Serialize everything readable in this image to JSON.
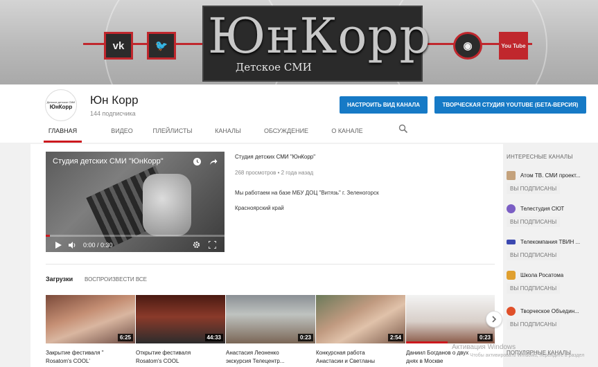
{
  "banner": {
    "logo": "ЮнКорр",
    "subtitle": "Детское СМИ",
    "social": [
      "vk-icon",
      "twitter-icon",
      "ok-icon",
      "youtube-icon"
    ],
    "social_labels": [
      "vk",
      "🐦",
      "◉",
      "You Tube"
    ],
    "accent": "#c0272d"
  },
  "channel": {
    "avatar_line1": "Детское детское СМИ",
    "avatar_line2": "ЮнКорр",
    "name": "Юн Корр",
    "subscribers": "144 подписчика",
    "btn_customize": "НАСТРОИТЬ ВИД КАНАЛА",
    "btn_studio": "ТВОРЧЕСКАЯ СТУДИЯ YOUTUBE (БЕТА-ВЕРСИЯ)",
    "tabs": [
      "ГЛАВНАЯ",
      "ВИДЕО",
      "ПЛЕЙЛИСТЫ",
      "КАНАЛЫ",
      "ОБСУЖДЕНИЕ",
      "О КАНАЛЕ"
    ],
    "accent": "#167ac6"
  },
  "featured": {
    "player_title": "Студия детских СМИ \"ЮнКорр\"",
    "time": "0:00 / 0:30",
    "title": "Студия детских СМИ \"ЮнКорр\"",
    "meta": "268 просмотров • 2 года назад",
    "desc_line1": "Мы работаем на базе  МБУ ДОЦ \"Витязь\" г. Зеленогорск",
    "desc_line2": "Красноярский край"
  },
  "uploads": {
    "heading": "Загрузки",
    "play_all": "ВОСПРОИЗВЕСТИ ВСЕ",
    "videos": [
      {
        "title1": "Закрытие фестиваля \"",
        "title2": "Rosatom's COOL'",
        "duration": "6:25"
      },
      {
        "title1": "Открытие фестиваля",
        "title2": "Rosatom's COOL",
        "duration": "44:33"
      },
      {
        "title1": "Анастасия Леоненко",
        "title2": "экскурсия Телецентр...",
        "duration": "0:23"
      },
      {
        "title1": "Конкурсная работа",
        "title2": "Анастасии и Светланы",
        "duration": "2:54"
      },
      {
        "title1": "Даниил Богданов о двух",
        "title2": "днях в Москве",
        "duration": "0:23"
      }
    ]
  },
  "sidebar": {
    "heading": "ИНТЕРЕСНЫЕ КАНАЛЫ",
    "subscribed_label": "ВЫ ПОДПИСАНЫ",
    "channels": [
      {
        "name": "Атом ТВ. СМИ проект..."
      },
      {
        "name": "Телестудия СЮТ"
      },
      {
        "name": "Телекомпания ТВИН ..."
      },
      {
        "name": "Школа Росатома"
      },
      {
        "name": "Творческое Объедин..."
      }
    ],
    "heading2": "ПОПУЛЯРНЫЕ КАНАЛЫ"
  },
  "watermark": {
    "line1": "Активация Windows",
    "line2": "Чтобы активировать Windows, перейдите в раздел"
  }
}
